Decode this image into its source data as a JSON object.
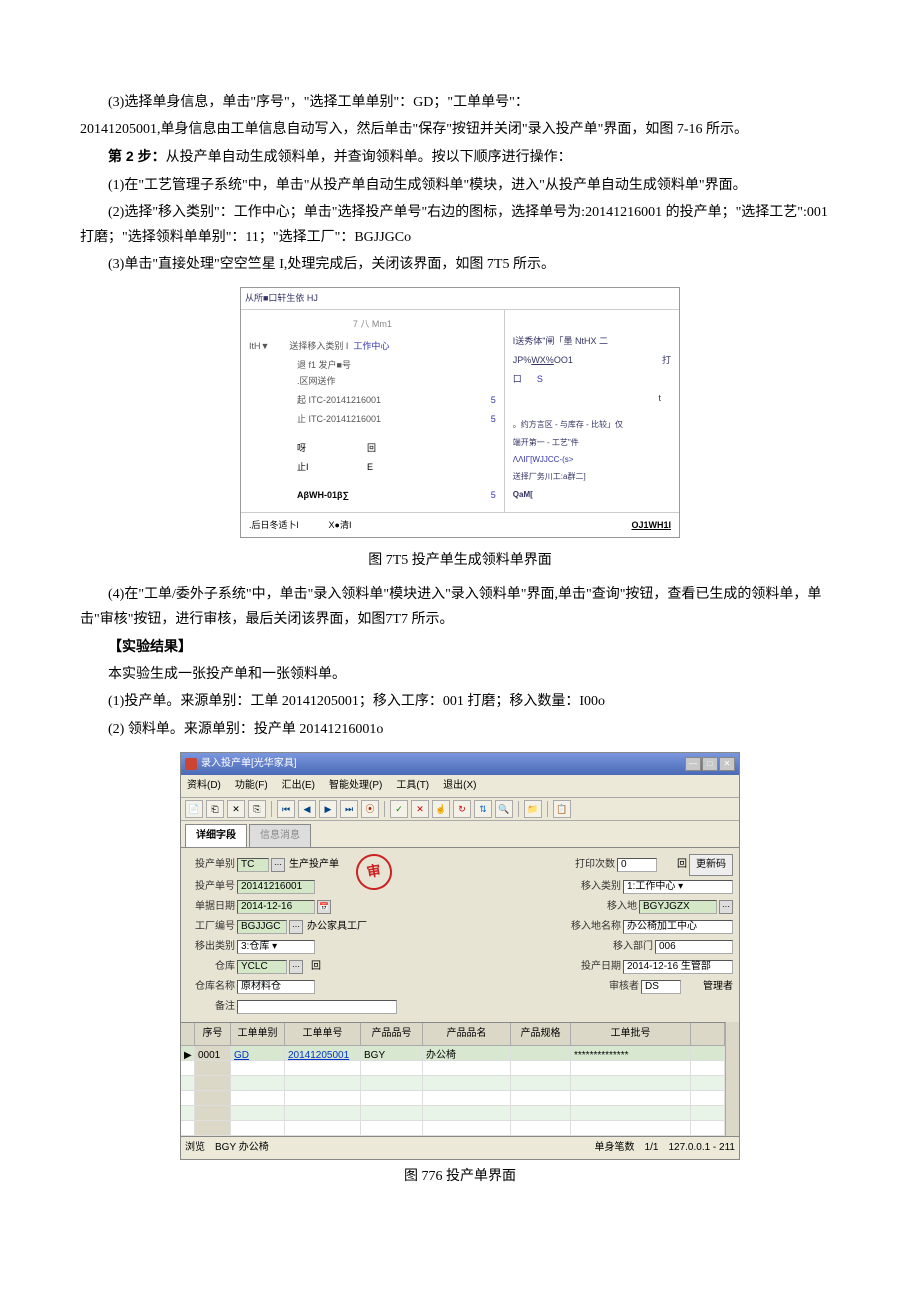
{
  "body": {
    "p1": "(3)选择单身信息，单击\"序号\"，\"选择工单单别\"：GD；\"工单单号\"：",
    "p1b": "20141205001,单身信息由工单信息自动写入，然后单击\"保存\"按钮并关闭\"录入投产单\"界面，如图 7-16 所示。",
    "p2_bold": "第 2 步：",
    "p2_rest": "从投产单自动生成领料单，并查询领料单。按以下顺序进行操作：",
    "p3": "(1)在\"工艺管理子系统\"中，单击\"从投产单自动生成领料单\"模块，进入\"从投产单自动生成领料单\"界面。",
    "p4": "(2)选择\"移入类别\"：工作中心；单击\"选择投产单号\"右边的图标，选择单号为:20141216001 的投产单；\"选择工艺\":001 打磨；\"选择领料单单别\"：11；\"选择工厂\"：BGJJGCo",
    "p5": "(3)单击\"直接处理\"空空竺星 I,处理完成后，关闭该界面，如图 7T5 所示。",
    "cap1": "图 7T5 投产单生成领料单界面",
    "p6": "(4)在\"工单/委外子系统\"中，单击\"录入领料单\"模块进入\"录入领料单\"界面,单击\"查询\"按钮，查看已生成的领料单，单击\"审核\"按钮，进行审核，最后关闭该界面，如图7T7 所示。",
    "p7_bold": "【实验结果】",
    "p8": "本实验生成一张投产单和一张领料单。",
    "p9": "(1)投产单。来源单别：工单 20141205001；移入工序：001 打磨；移入数量：I00o",
    "p10": "(2) 领料单。来源单别：投产单 20141216001o",
    "cap2": "图 776 投产单界面"
  },
  "fig1": {
    "header": "从所■口轩生依 HJ",
    "center": "7 八 Mm1",
    "left_marker": "ItH▼",
    "row1_lbl": "送择移入类别 I",
    "row1_val": "工作中心",
    "row2_lbl": "退 f1 发户■号",
    "row2b": ".区网送作",
    "row3_lbl": "起 ITC-20141216001",
    "row3_num": "5",
    "row4_lbl": "止 ITC-20141216001",
    "row4_num": "5",
    "row5a": "呀",
    "row5b": "回",
    "row6a": "止I",
    "row6b": "E",
    "row7_lbl": "AβWH-01β∑",
    "row7_num": "5",
    "right1": "I送秀体\"闸「墨 NtHX 二",
    "right2": "JP%WX%OO1",
    "right2b": "打",
    "right3a": "口",
    "right3b": "S",
    "right4": "t",
    "right5": "。约方言区 - 与库存 - 比较」仅",
    "right6": "端开第一 - 工艺\"件",
    "right7": "ΛΛIΓ[WJJCC-(s>",
    "right8": "送择厂务川工:a群二]",
    "right9": "QaM[",
    "foot1": ".后日冬适卜l",
    "foot2": "X●清I",
    "foot3": "OJ1WH1I"
  },
  "fig2": {
    "title_icon": "🥀",
    "title": "录入投产单[光华家具]",
    "win_min": "—",
    "win_max": "□",
    "win_close": "✕",
    "menu": [
      "资料(D)",
      "功能(F)",
      "汇出(E)",
      "智能处理(P)",
      "工具(T)",
      "退出(X)"
    ],
    "toolbar": [
      "📄",
      "⎗",
      "✕",
      "⎘",
      "-",
      "⏮",
      "◀",
      "▶",
      "⏭",
      "⦿",
      "-",
      "✓",
      "✕",
      "☝",
      "↻",
      "⇅",
      "🔍",
      "-",
      "📁",
      "-",
      "📋",
      "-"
    ],
    "tab_active": "详细字段",
    "tab_inactive": "信息消息",
    "btn_update": "更新码",
    "btn_update_pre": "回",
    "stamp": "审",
    "form": {
      "f1_lbl": "投产单别",
      "f1_val": "TC",
      "f1_ext": "生产投产单",
      "f2_lbl": "打印次数",
      "f2_val": "0",
      "f3_lbl": "投产单号",
      "f3_val": "20141216001",
      "f4_lbl": "移入类别",
      "f4_val": "1:工作中心 ▾",
      "f5_lbl": "单据日期",
      "f5_val": "2014-12-16",
      "f6_lbl": "移入地",
      "f6_val": "BGYJGZX",
      "f7_lbl": "工厂编号",
      "f7_val": "BGJJGC",
      "f7_ext": "办公家具工厂",
      "f8_lbl": "移入地名称",
      "f8_val": "办公椅加工中心",
      "f9_lbl": "移出类别",
      "f9_val": "3:仓库 ▾",
      "f10_lbl": "移入部门",
      "f10_val": "006",
      "f11_lbl": "仓库",
      "f11_val": "YCLC",
      "f11_ext": "回",
      "f12_lbl": "投产日期",
      "f12_val": "2014-12-16 生管部",
      "f13_lbl": "仓库名称",
      "f13_val": "原材料仓",
      "f14_lbl": "审核者",
      "f14_val": "DS",
      "f14_ext": "管理者",
      "f15_lbl": "备注",
      "f15_val": ""
    },
    "grid": {
      "headers": [
        "序号",
        "工单单别",
        "工单单号",
        "产品品号",
        "产品品名",
        "产品规格",
        "工单批号"
      ],
      "row1_marker": "▶",
      "row1": [
        "0001",
        "GD",
        "20141205001",
        "BGY",
        "办公椅",
        "",
        "**************"
      ]
    },
    "status": {
      "left1": "浏览",
      "left2": "BGY 办公椅",
      "right1_lbl": "单身笔数",
      "right1_val": "1/1",
      "right2": "127.0.0.1 - 211"
    }
  }
}
